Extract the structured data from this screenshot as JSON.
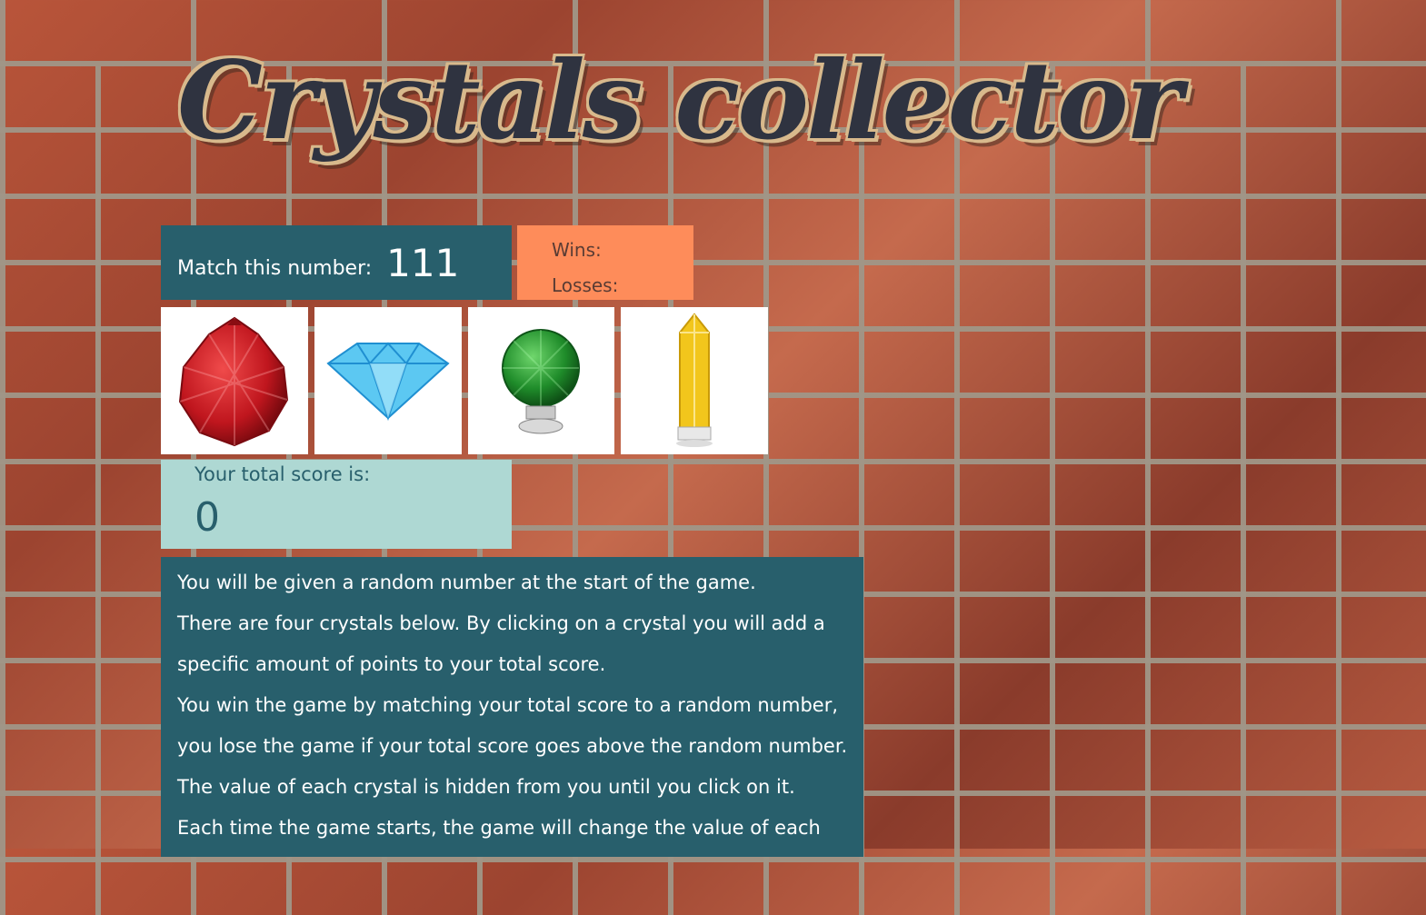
{
  "title": "Crystals collector",
  "target": {
    "label": "Match this number:",
    "value": "111"
  },
  "record": {
    "wins_label": "Wins:",
    "losses_label": "Losses:"
  },
  "crystals": [
    {
      "name": "red-crystal-icon",
      "color": "#c0161e"
    },
    {
      "name": "blue-diamond-icon",
      "color": "#3fb4ea"
    },
    {
      "name": "green-crystal-knob-icon",
      "color": "#1f8c2a"
    },
    {
      "name": "yellow-crystal-icon",
      "color": "#f2c61c"
    }
  ],
  "total": {
    "label": "Your total score is:",
    "value": "0"
  },
  "instructions": [
    "You will be given a random number at the start of the game.",
    "There are four crystals below. By clicking on a crystal you will add a",
    "specific amount of points to your total score.",
    "You win the game by matching your total score to a random number,",
    "you lose the game if your total score goes above the random number.",
    "The value of each crystal is hidden from you until you click on it.",
    "Each time the game starts, the game will change the value of each"
  ],
  "colors": {
    "panel_dark": "#285f6c",
    "panel_orange": "#fe8c5a",
    "panel_light": "#aed8d3"
  }
}
